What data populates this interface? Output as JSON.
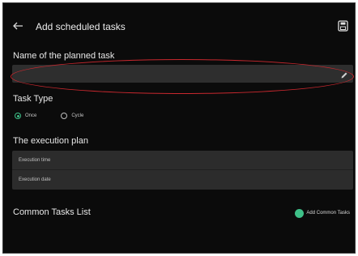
{
  "header": {
    "title": "Add scheduled tasks",
    "back_icon": "back-arrow-icon",
    "save_icon": "save-icon"
  },
  "task_name": {
    "label": "Name of the planned task",
    "value": "",
    "edit_icon": "pencil-icon"
  },
  "task_type": {
    "label": "Task Type",
    "options": [
      {
        "label": "Once",
        "selected": true
      },
      {
        "label": "Cycle",
        "selected": false
      }
    ]
  },
  "execution_plan": {
    "label": "The execution plan",
    "rows": [
      "Execution time",
      "Execution date"
    ]
  },
  "common_tasks": {
    "label": "Common Tasks List",
    "add_label": "Add Common Tasks"
  },
  "colors": {
    "background": "#0b0b0b",
    "field": "#2e2e2e",
    "accent": "#3ec088",
    "highlight": "#c8282e"
  }
}
